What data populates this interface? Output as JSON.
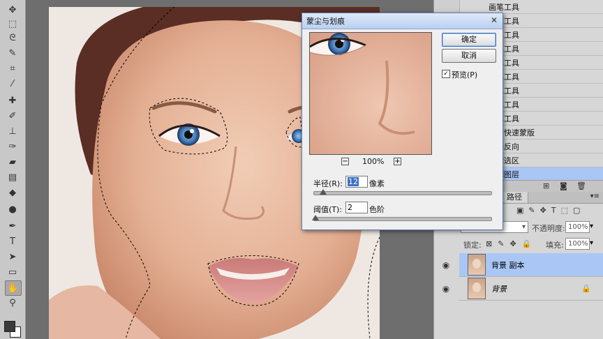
{
  "history_panel": {
    "items": [
      {
        "label": "画笔工具"
      },
      {
        "label": "画笔工具"
      },
      {
        "label": "画笔工具"
      },
      {
        "label": "画笔工具"
      },
      {
        "label": "画笔工具"
      },
      {
        "label": "画笔工具"
      },
      {
        "label": "画笔工具"
      },
      {
        "label": "画笔工具"
      },
      {
        "label": "画笔工具"
      },
      {
        "label": "退出快速蒙版"
      },
      {
        "label": "选择反向"
      },
      {
        "label": "存储选区"
      },
      {
        "label": "复制图层"
      }
    ],
    "selected_index": 12
  },
  "layers_panel": {
    "tab_paths": "路径",
    "opacity_label": "不透明度:",
    "opacity_value": "100%",
    "lock_label": "锁定:",
    "fill_label": "填充:",
    "fill_value": "100%",
    "layers": [
      {
        "name": "背景 副本",
        "selected": true
      },
      {
        "name": "背景",
        "selected": false
      }
    ]
  },
  "dialog": {
    "title": "蒙尘与划痕",
    "ok_label": "确定",
    "cancel_label": "取消",
    "preview_label": "预览(P)",
    "preview_checked": true,
    "zoom": "100%",
    "zoom_out": "−",
    "zoom_in": "+",
    "radius_label": "半径(R):",
    "radius_value": "12",
    "radius_unit": "像素",
    "threshold_label": "阈值(T):",
    "threshold_value": "2",
    "threshold_unit": "色阶"
  },
  "colors": {
    "selection_highlight": "#a9c6f5",
    "dialog_border": "#5c7fb5"
  },
  "tools": [
    "marquee-icon",
    "lasso-icon",
    "quick-select-icon",
    "crop-icon",
    "eyedropper-icon",
    "healing-icon",
    "brush-icon",
    "stamp-icon",
    "history-brush-icon",
    "eraser-icon",
    "gradient-icon",
    "blur-icon",
    "dodge-icon",
    "pen-icon",
    "type-icon",
    "path-select-icon",
    "shape-icon",
    "hand-icon",
    "zoom-icon"
  ]
}
